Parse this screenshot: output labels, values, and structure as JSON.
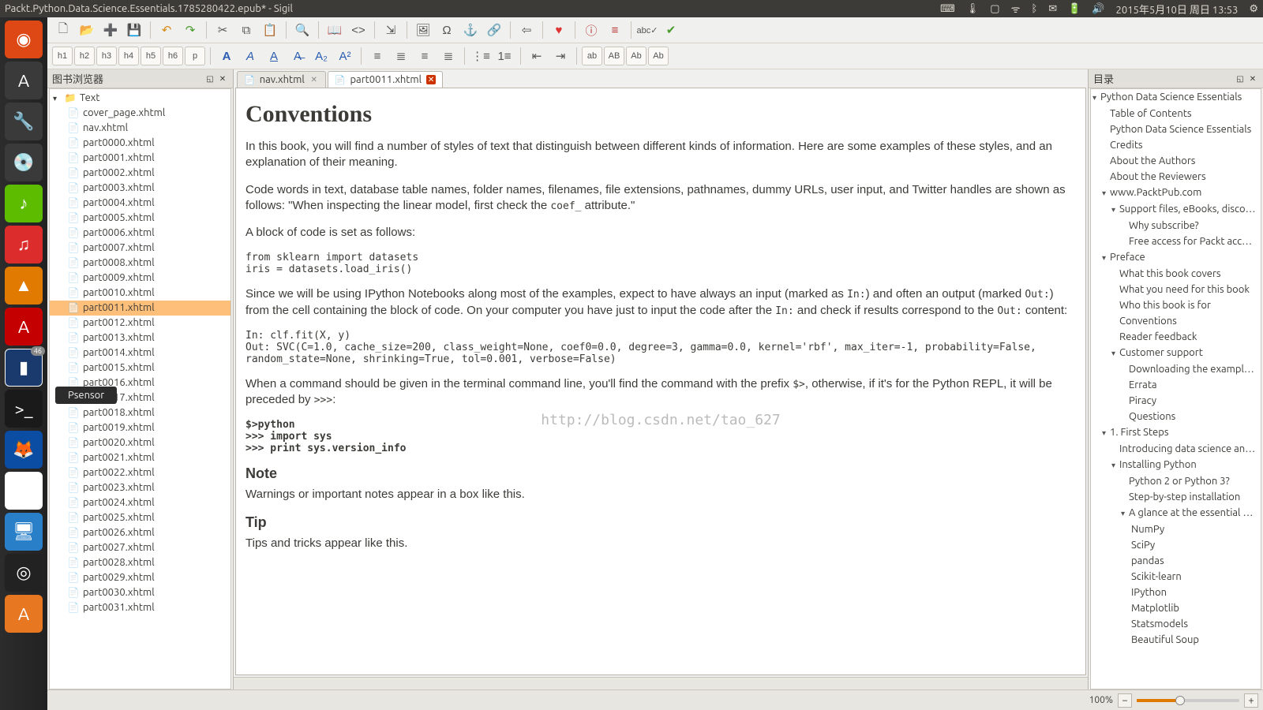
{
  "window": {
    "title": "Packt.Python.Data.Science.Essentials.1785280422.epub* - Sigil"
  },
  "topbar": {
    "clock": "2015年5月10日 周日  13:53"
  },
  "book_browser": {
    "title": "图书浏览器",
    "folder": "Text",
    "selected": "part0011.xhtml",
    "files": [
      "cover_page.xhtml",
      "nav.xhtml",
      "part0000.xhtml",
      "part0001.xhtml",
      "part0002.xhtml",
      "part0003.xhtml",
      "part0004.xhtml",
      "part0005.xhtml",
      "part0006.xhtml",
      "part0007.xhtml",
      "part0008.xhtml",
      "part0009.xhtml",
      "part0010.xhtml",
      "part0011.xhtml",
      "part0012.xhtml",
      "part0013.xhtml",
      "part0014.xhtml",
      "part0015.xhtml",
      "part0016.xhtml",
      "part0017.xhtml",
      "part0018.xhtml",
      "part0019.xhtml",
      "part0020.xhtml",
      "part0021.xhtml",
      "part0022.xhtml",
      "part0023.xhtml",
      "part0024.xhtml",
      "part0025.xhtml",
      "part0026.xhtml",
      "part0027.xhtml",
      "part0028.xhtml",
      "part0029.xhtml",
      "part0030.xhtml",
      "part0031.xhtml"
    ]
  },
  "tabs": [
    {
      "name": "nav.xhtml",
      "dirty": false
    },
    {
      "name": "part0011.xhtml",
      "dirty": true
    }
  ],
  "content": {
    "h1": "Conventions",
    "p1": "In this book, you will find a number of styles of text that distinguish between different kinds of information. Here are some examples of these styles, and an explanation of their meaning.",
    "p2a": "Code words in text, database table names, folder names, filenames, file extensions, pathnames, dummy URLs, user input, and Twitter handles are shown as follows: \"When inspecting the linear model, first check the ",
    "p2code": "coef_",
    "p2b": " attribute.\"",
    "p3": "A block of code is set as follows:",
    "code1": "from sklearn import datasets\niris = datasets.load_iris()",
    "p4a": "Since we will be using IPython Notebooks along most of the examples, expect to have always an input (marked as ",
    "p4in": "In:",
    "p4b": ") and often an output (marked ",
    "p4out": "Out:",
    "p4c": ") from the cell containing the block of code. On your computer you have just to input the code after the ",
    "p4in2": "In:",
    "p4d": " and check if results correspond to the ",
    "p4out2": "Out:",
    "p4e": " content:",
    "code2": "In: clf.fit(X, y)\nOut: SVC(C=1.0, cache_size=200, class_weight=None, coef0=0.0, degree=3, gamma=0.0, kernel='rbf', max_iter=-1, probability=False, random_state=None, shrinking=True, tol=0.001, verbose=False)",
    "p5a": "When a command should be given in the terminal command line, you'll find the command with the prefix ",
    "p5code": "$>",
    "p5b": ", otherwise, if it's for the Python REPL, it will be preceded by ",
    "p5code2": ">>>",
    "p5c": ":",
    "code3": "$>python\n>>> import sys\n>>> print sys.version_info",
    "note_h": "Note",
    "note_p": "Warnings or important notes appear in a box like this.",
    "tip_h": "Tip",
    "tip_p": "Tips and tricks appear like this.",
    "watermark": "http://blog.csdn.net/tao_627"
  },
  "toc": {
    "title": "目录",
    "items": [
      {
        "l": 0,
        "tw": "▾",
        "t": "Python Data Science Essentials"
      },
      {
        "l": 1,
        "tw": "",
        "t": "Table of Contents"
      },
      {
        "l": 1,
        "tw": "",
        "t": "Python Data Science Essentials"
      },
      {
        "l": 1,
        "tw": "",
        "t": "Credits"
      },
      {
        "l": 1,
        "tw": "",
        "t": "About the Authors"
      },
      {
        "l": 1,
        "tw": "",
        "t": "About the Reviewers"
      },
      {
        "l": 1,
        "tw": "▾",
        "t": "www.PacktPub.com"
      },
      {
        "l": 2,
        "tw": "▾",
        "t": "Support files, eBooks, disco…"
      },
      {
        "l": 3,
        "tw": "",
        "t": "Why subscribe?"
      },
      {
        "l": 3,
        "tw": "",
        "t": "Free access for Packt acco…"
      },
      {
        "l": 1,
        "tw": "▾",
        "t": "Preface"
      },
      {
        "l": 2,
        "tw": "",
        "t": "What this book covers"
      },
      {
        "l": 2,
        "tw": "",
        "t": "What you need for this book"
      },
      {
        "l": 2,
        "tw": "",
        "t": "Who this book is for"
      },
      {
        "l": 2,
        "tw": "",
        "t": "Conventions"
      },
      {
        "l": 2,
        "tw": "",
        "t": "Reader feedback"
      },
      {
        "l": 2,
        "tw": "▾",
        "t": "Customer support"
      },
      {
        "l": 3,
        "tw": "",
        "t": "Downloading the example…"
      },
      {
        "l": 3,
        "tw": "",
        "t": "Errata"
      },
      {
        "l": 3,
        "tw": "",
        "t": "Piracy"
      },
      {
        "l": 3,
        "tw": "",
        "t": "Questions"
      },
      {
        "l": 1,
        "tw": "▾",
        "t": "1. First Steps"
      },
      {
        "l": 2,
        "tw": "",
        "t": "Introducing data science an…"
      },
      {
        "l": 2,
        "tw": "▾",
        "t": "Installing Python"
      },
      {
        "l": 3,
        "tw": "",
        "t": "Python 2 or Python 3?"
      },
      {
        "l": 3,
        "tw": "",
        "t": "Step-by-step installation"
      },
      {
        "l": 3,
        "tw": "▾",
        "t": "A glance at the essential P…"
      },
      {
        "l": 3,
        "tw": "",
        "t": "    NumPy"
      },
      {
        "l": 3,
        "tw": "",
        "t": "    SciPy"
      },
      {
        "l": 3,
        "tw": "",
        "t": "    pandas"
      },
      {
        "l": 3,
        "tw": "",
        "t": "    Scikit-learn"
      },
      {
        "l": 3,
        "tw": "",
        "t": "    IPython"
      },
      {
        "l": 3,
        "tw": "",
        "t": "    Matplotlib"
      },
      {
        "l": 3,
        "tw": "",
        "t": "    Statsmodels"
      },
      {
        "l": 3,
        "tw": "",
        "t": "    Beautiful Soup"
      }
    ]
  },
  "status": {
    "zoom": "100%"
  },
  "launcher": {
    "tooltip": "Psensor",
    "badge": "46"
  },
  "headings": {
    "h1": "h1",
    "h2": "h2",
    "h3": "h3",
    "h4": "h4",
    "h5": "h5",
    "h6": "h6",
    "p": "p"
  }
}
